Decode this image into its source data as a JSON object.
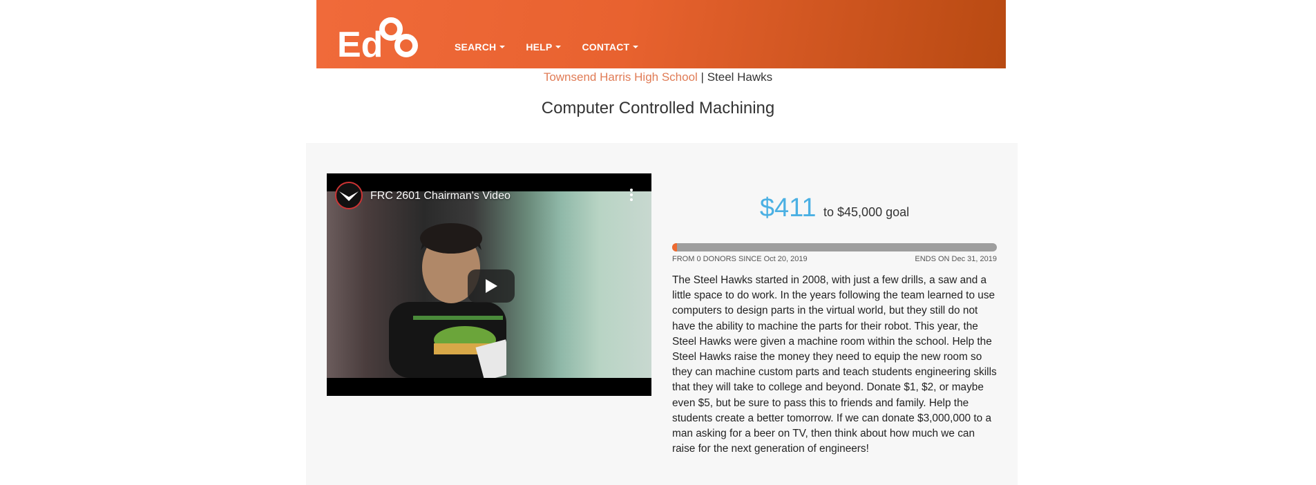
{
  "header": {
    "logo_text": "EdCo",
    "nav": [
      {
        "label": "SEARCH"
      },
      {
        "label": "HELP"
      },
      {
        "label": "CONTACT"
      }
    ]
  },
  "school": {
    "name": "Townsend Harris High School",
    "separator": " | ",
    "team": "Steel Hawks"
  },
  "project": {
    "title": "Computer Controlled Machining"
  },
  "video": {
    "title": "FRC 2601 Chairman's Video"
  },
  "funding": {
    "amount": "$411",
    "goal_text": "to $45,000 goal",
    "progress_fraction": 0.009,
    "donors_text": "FROM 0 DONORS SINCE Oct 20, 2019",
    "ends_text": "ENDS ON Dec 31, 2019"
  },
  "description": "The Steel Hawks started in 2008, with just a few drills, a saw and a little space to do work. In the years following the team learned to use computers to design parts in the virtual world, but they still do not have the ability to machine the parts for their robot. This year, the Steel Hawks were given a machine room within the school. Help the Steel Hawks raise the money they need to equip the new room so they can machine custom parts and teach students engineering skills that they will take to college and beyond. Donate $1, $2, or maybe even $5, but be sure to pass this to friends and family. Help the students create a better tomorrow. If we can donate $3,000,000 to a man asking for a beer on TV, then think about how much we can raise for the next generation of engineers!",
  "colors": {
    "brand_orange": "#f06a3a",
    "amount_blue": "#4bb0e3",
    "school_link": "#e07b55"
  }
}
